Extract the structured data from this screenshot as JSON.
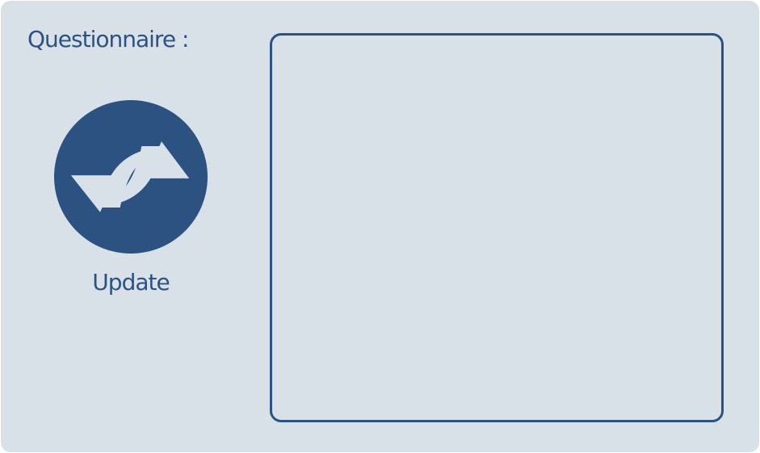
{
  "title": "Questionnaire :",
  "update_button": {
    "label": "Update",
    "icon": "refresh-icon"
  },
  "colors": {
    "background": "#d9e1e8",
    "accent": "#2c5282"
  }
}
